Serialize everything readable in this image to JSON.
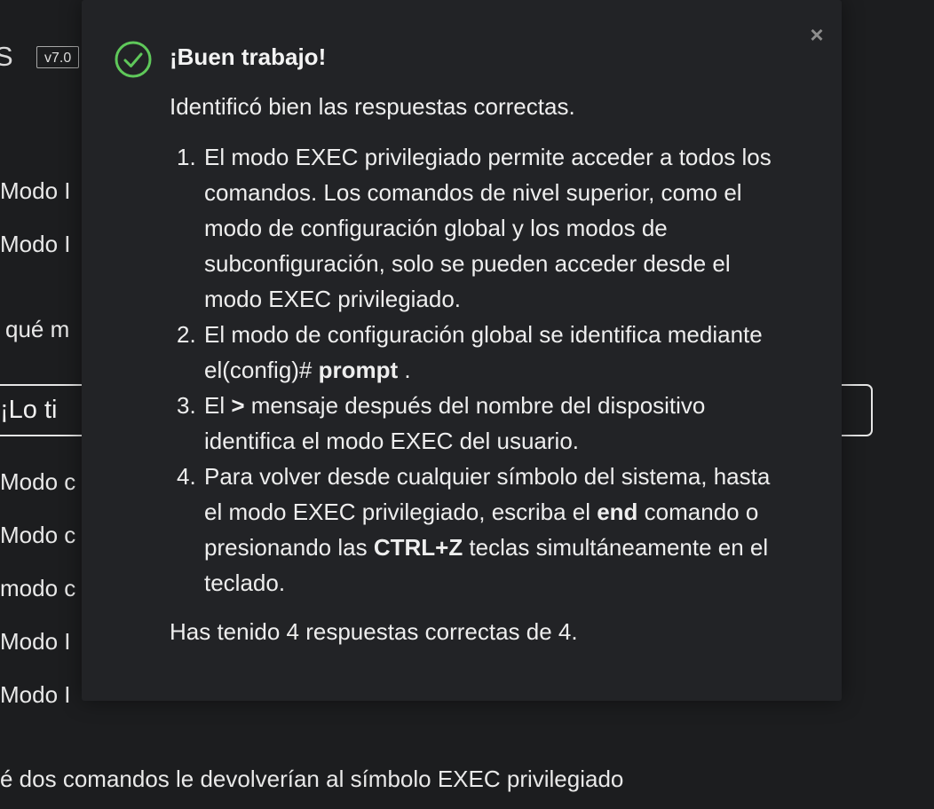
{
  "background": {
    "header_partial": "S",
    "version_badge": "v7.0",
    "options_top": [
      "Modo I",
      "Modo I"
    ],
    "question_partial": "qué m",
    "answer_box": "¡Lo ti",
    "options_bottom": [
      "Modo c",
      "Modo c",
      "modo c",
      "Modo I",
      "Modo I"
    ],
    "bottom_question": "é dos comandos le devolverían al símbolo EXEC privilegiado"
  },
  "modal": {
    "close_icon": "×",
    "icon": "check-circle-icon",
    "title": "¡Buen trabajo!",
    "subtitle": "Identificó bien las respuestas correctas.",
    "items": [
      {
        "num": "1.",
        "text": "El modo EXEC privilegiado permite acceder a todos los comandos. Los comandos de nivel superior, como el modo de configuración global y los modos de subconfiguración, solo se pueden acceder desde el modo EXEC privilegiado."
      },
      {
        "num": "2.",
        "text_pre": "El modo de configuración global se identifica mediante el(config)# ",
        "text_bold": "prompt",
        "text_post": " ."
      },
      {
        "num": "3.",
        "text_pre": "El ",
        "text_bold": ">",
        "text_post": " mensaje después del nombre del dispositivo identifica el modo EXEC del usuario."
      },
      {
        "num": "4.",
        "text_pre": "Para volver desde cualquier símbolo del sistema, hasta el modo EXEC privilegiado, escriba el ",
        "text_bold": "end",
        "text_mid": " comando o presionando las ",
        "text_bold2": "CTRL+Z",
        "text_post": " teclas simultáneamente en el teclado."
      }
    ],
    "score": "Has tenido 4 respuestas correctas de 4."
  },
  "colors": {
    "page_background": "#1c1d1f",
    "modal_background": "#222326",
    "success_green": "#5fc85a"
  }
}
